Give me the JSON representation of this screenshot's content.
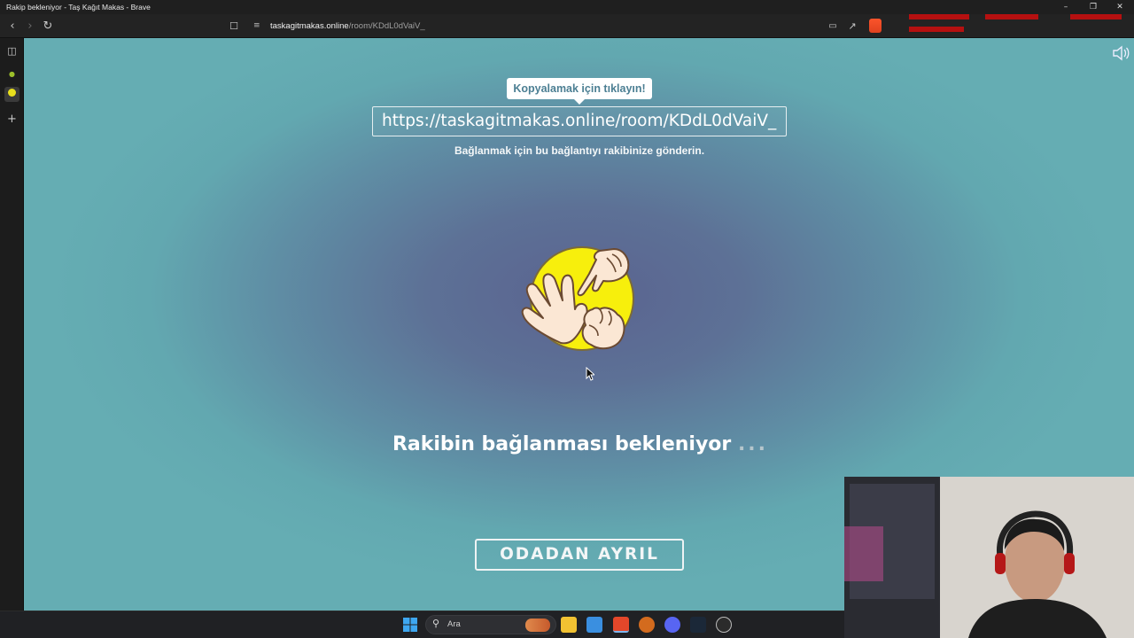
{
  "window": {
    "title": "Rakip bekleniyor - Taş Kağıt Makas - Brave",
    "minimize_icon": "minimize-icon",
    "maximize_icon": "restore-icon",
    "close_icon": "close-icon"
  },
  "toolbar": {
    "url_host": "taskagitmakas.online",
    "url_path": "/room/KDdL0dVaiV_"
  },
  "page": {
    "tooltip": "Kopyalamak için tıklayın!",
    "room_link": "https://taskagitmakas.online/room/KDdL0dVaiV_",
    "hint": "Bağlanmak için bu bağlantıyı rakibinize gönderin.",
    "waiting_text": "Rakibin bağlanması bekleniyor",
    "waiting_dots": "...",
    "leave_button": "ODADAN AYRIL"
  },
  "taskbar": {
    "search_label": "Ara"
  },
  "colors": {
    "page_center": "#5a6390",
    "page_edge": "#65adb3",
    "tooltip_text": "#4c7f93",
    "logo_yellow": "#f7ef0c"
  }
}
